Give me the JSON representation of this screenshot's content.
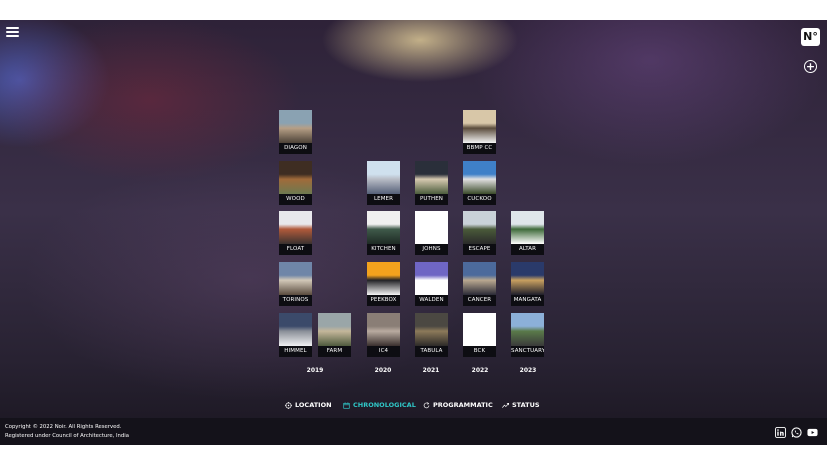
{
  "header": {
    "menu_icon": "hamburger-menu-icon",
    "logo_text": "N°",
    "add_icon": "plus-circle-icon"
  },
  "projects": [
    {
      "label": "DIAGON",
      "year": "2019",
      "thumb": [
        "#8aa2b2",
        "#b69f86",
        "#4c4238"
      ]
    },
    {
      "label": "WOOD",
      "year": "2019",
      "thumb": [
        "#3e2d22",
        "#a06a3a",
        "#6d7a50"
      ]
    },
    {
      "label": "FLOAT",
      "year": "2019",
      "thumb": [
        "#e8e8ec",
        "#b15a3b",
        "#3a3230"
      ]
    },
    {
      "label": "TORINOS",
      "year": "2019",
      "thumb": [
        "#6f86a8",
        "#d2c8b8",
        "#5a4b3e"
      ]
    },
    {
      "label": "HIMMEL",
      "year": "2019",
      "thumb": [
        "#3b4a6a",
        "#8a8f98",
        "#f0f0f2"
      ]
    },
    {
      "label": "FARM",
      "year": "2019",
      "thumb": [
        "#9aa6a8",
        "#c4b79a",
        "#4f5b3e"
      ]
    },
    {
      "label": "LEMER",
      "year": "2020",
      "thumb": [
        "#cfe0ee",
        "#b8bcc6",
        "#556078"
      ]
    },
    {
      "label": "KITCHEN",
      "year": "2020",
      "thumb": [
        "#f0f0f0",
        "#3f5a4a",
        "#1e2a24"
      ]
    },
    {
      "label": "PEEKBOX",
      "year": "2020",
      "thumb": [
        "#f3a21d",
        "#222226",
        "#f6f6f6"
      ]
    },
    {
      "label": "IC4",
      "year": "2020",
      "thumb": [
        "#8a7e76",
        "#b9aba0",
        "#3a302e"
      ]
    },
    {
      "label": "PUTHEN",
      "year": "2021",
      "thumb": [
        "#2a2f3a",
        "#d6c9b0",
        "#4b5c3c"
      ]
    },
    {
      "label": "JOHNS",
      "year": "2021",
      "thumb": [
        "#ffffff",
        "#ffffff",
        "#ffffff"
      ]
    },
    {
      "label": "WALDEN",
      "year": "2021",
      "thumb": [
        "#6f66c4",
        "#ffffff",
        "#ffffff"
      ]
    },
    {
      "label": "TABULA",
      "year": "2021",
      "thumb": [
        "#4b4842",
        "#8c7a5a",
        "#2c2a28"
      ]
    },
    {
      "label": "BBMP CC",
      "year": "2022",
      "thumb": [
        "#d8c7a8",
        "#5b4c3c",
        "#f4f4f4"
      ]
    },
    {
      "label": "CUCKOO",
      "year": "2022",
      "thumb": [
        "#3f80c8",
        "#e0e0e0",
        "#3a4a2a"
      ]
    },
    {
      "label": "ESCAPE",
      "year": "2022",
      "thumb": [
        "#c9d2d8",
        "#4a5a3a",
        "#2a2a2a"
      ]
    },
    {
      "label": "CANCER",
      "year": "2022",
      "thumb": [
        "#4c6a9c",
        "#b9a890",
        "#2a2a36"
      ]
    },
    {
      "label": "BCK",
      "year": "2022",
      "thumb": [
        "#ffffff",
        "#ffffff",
        "#ffffff"
      ]
    },
    {
      "label": "ALTAR",
      "year": "2023",
      "thumb": [
        "#dfe6ea",
        "#3e6a3a",
        "#ffffff"
      ]
    },
    {
      "label": "MANGATA",
      "year": "2023",
      "thumb": [
        "#2a3a6a",
        "#c8a060",
        "#1e1e2a"
      ]
    },
    {
      "label": "SANCTUARY",
      "year": "2023",
      "thumb": [
        "#8cb0d8",
        "#5a7a4a",
        "#3a3a3a"
      ]
    }
  ],
  "years": [
    "2019",
    "2020",
    "2021",
    "2022",
    "2023"
  ],
  "view_nav": [
    {
      "label": "LOCATION",
      "icon": "target-icon",
      "active": false
    },
    {
      "label": "CHRONOLOGICAL",
      "icon": "calendar-icon",
      "active": true
    },
    {
      "label": "PROGRAMMATIC",
      "icon": "refresh-icon",
      "active": false
    },
    {
      "label": "STATUS",
      "icon": "trend-icon",
      "active": false
    }
  ],
  "colors": {
    "accent": "#2fc7c7",
    "label_bg": "#0d0d12",
    "footer_bg": "#14121a"
  },
  "footer": {
    "copyright": "Copyright © 2022 Noir. All Rights Reserved.",
    "registration": "Registered under Council of Architecture, India",
    "social": [
      "linkedin-icon",
      "whatsapp-icon",
      "youtube-icon"
    ]
  }
}
